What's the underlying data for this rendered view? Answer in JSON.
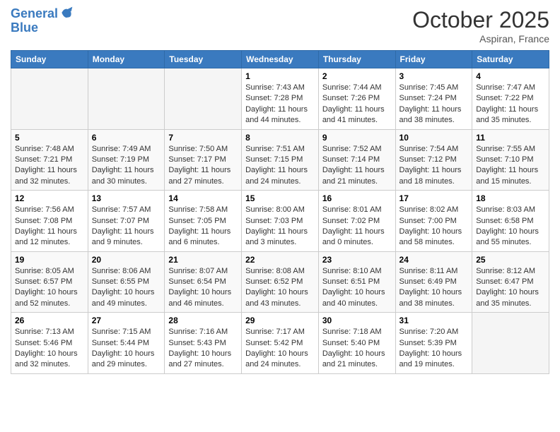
{
  "header": {
    "logo_line1": "General",
    "logo_line2": "Blue",
    "month": "October 2025",
    "location": "Aspiran, France"
  },
  "weekdays": [
    "Sunday",
    "Monday",
    "Tuesday",
    "Wednesday",
    "Thursday",
    "Friday",
    "Saturday"
  ],
  "weeks": [
    [
      {
        "day": "",
        "info": ""
      },
      {
        "day": "",
        "info": ""
      },
      {
        "day": "",
        "info": ""
      },
      {
        "day": "1",
        "info": "Sunrise: 7:43 AM\nSunset: 7:28 PM\nDaylight: 11 hours and 44 minutes."
      },
      {
        "day": "2",
        "info": "Sunrise: 7:44 AM\nSunset: 7:26 PM\nDaylight: 11 hours and 41 minutes."
      },
      {
        "day": "3",
        "info": "Sunrise: 7:45 AM\nSunset: 7:24 PM\nDaylight: 11 hours and 38 minutes."
      },
      {
        "day": "4",
        "info": "Sunrise: 7:47 AM\nSunset: 7:22 PM\nDaylight: 11 hours and 35 minutes."
      }
    ],
    [
      {
        "day": "5",
        "info": "Sunrise: 7:48 AM\nSunset: 7:21 PM\nDaylight: 11 hours and 32 minutes."
      },
      {
        "day": "6",
        "info": "Sunrise: 7:49 AM\nSunset: 7:19 PM\nDaylight: 11 hours and 30 minutes."
      },
      {
        "day": "7",
        "info": "Sunrise: 7:50 AM\nSunset: 7:17 PM\nDaylight: 11 hours and 27 minutes."
      },
      {
        "day": "8",
        "info": "Sunrise: 7:51 AM\nSunset: 7:15 PM\nDaylight: 11 hours and 24 minutes."
      },
      {
        "day": "9",
        "info": "Sunrise: 7:52 AM\nSunset: 7:14 PM\nDaylight: 11 hours and 21 minutes."
      },
      {
        "day": "10",
        "info": "Sunrise: 7:54 AM\nSunset: 7:12 PM\nDaylight: 11 hours and 18 minutes."
      },
      {
        "day": "11",
        "info": "Sunrise: 7:55 AM\nSunset: 7:10 PM\nDaylight: 11 hours and 15 minutes."
      }
    ],
    [
      {
        "day": "12",
        "info": "Sunrise: 7:56 AM\nSunset: 7:08 PM\nDaylight: 11 hours and 12 minutes."
      },
      {
        "day": "13",
        "info": "Sunrise: 7:57 AM\nSunset: 7:07 PM\nDaylight: 11 hours and 9 minutes."
      },
      {
        "day": "14",
        "info": "Sunrise: 7:58 AM\nSunset: 7:05 PM\nDaylight: 11 hours and 6 minutes."
      },
      {
        "day": "15",
        "info": "Sunrise: 8:00 AM\nSunset: 7:03 PM\nDaylight: 11 hours and 3 minutes."
      },
      {
        "day": "16",
        "info": "Sunrise: 8:01 AM\nSunset: 7:02 PM\nDaylight: 11 hours and 0 minutes."
      },
      {
        "day": "17",
        "info": "Sunrise: 8:02 AM\nSunset: 7:00 PM\nDaylight: 10 hours and 58 minutes."
      },
      {
        "day": "18",
        "info": "Sunrise: 8:03 AM\nSunset: 6:58 PM\nDaylight: 10 hours and 55 minutes."
      }
    ],
    [
      {
        "day": "19",
        "info": "Sunrise: 8:05 AM\nSunset: 6:57 PM\nDaylight: 10 hours and 52 minutes."
      },
      {
        "day": "20",
        "info": "Sunrise: 8:06 AM\nSunset: 6:55 PM\nDaylight: 10 hours and 49 minutes."
      },
      {
        "day": "21",
        "info": "Sunrise: 8:07 AM\nSunset: 6:54 PM\nDaylight: 10 hours and 46 minutes."
      },
      {
        "day": "22",
        "info": "Sunrise: 8:08 AM\nSunset: 6:52 PM\nDaylight: 10 hours and 43 minutes."
      },
      {
        "day": "23",
        "info": "Sunrise: 8:10 AM\nSunset: 6:51 PM\nDaylight: 10 hours and 40 minutes."
      },
      {
        "day": "24",
        "info": "Sunrise: 8:11 AM\nSunset: 6:49 PM\nDaylight: 10 hours and 38 minutes."
      },
      {
        "day": "25",
        "info": "Sunrise: 8:12 AM\nSunset: 6:47 PM\nDaylight: 10 hours and 35 minutes."
      }
    ],
    [
      {
        "day": "26",
        "info": "Sunrise: 7:13 AM\nSunset: 5:46 PM\nDaylight: 10 hours and 32 minutes."
      },
      {
        "day": "27",
        "info": "Sunrise: 7:15 AM\nSunset: 5:44 PM\nDaylight: 10 hours and 29 minutes."
      },
      {
        "day": "28",
        "info": "Sunrise: 7:16 AM\nSunset: 5:43 PM\nDaylight: 10 hours and 27 minutes."
      },
      {
        "day": "29",
        "info": "Sunrise: 7:17 AM\nSunset: 5:42 PM\nDaylight: 10 hours and 24 minutes."
      },
      {
        "day": "30",
        "info": "Sunrise: 7:18 AM\nSunset: 5:40 PM\nDaylight: 10 hours and 21 minutes."
      },
      {
        "day": "31",
        "info": "Sunrise: 7:20 AM\nSunset: 5:39 PM\nDaylight: 10 hours and 19 minutes."
      },
      {
        "day": "",
        "info": ""
      }
    ]
  ]
}
